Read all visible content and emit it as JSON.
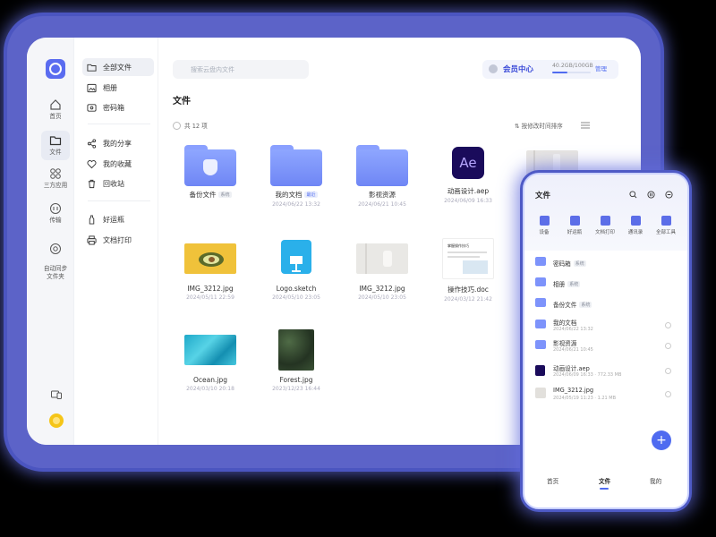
{
  "rail": {
    "items": [
      {
        "label": "首页",
        "icon": "home-icon"
      },
      {
        "label": "文件",
        "icon": "folder-icon"
      },
      {
        "label": "三方应用",
        "icon": "apps-icon"
      },
      {
        "label": "传输",
        "icon": "transfer-icon"
      },
      {
        "label": "自动同步\n文件夹",
        "icon": "sync-icon"
      }
    ]
  },
  "sidebar": {
    "items": [
      {
        "label": "全部文件",
        "icon": "folder-icon"
      },
      {
        "label": "相册",
        "icon": "image-icon"
      },
      {
        "label": "密码箱",
        "icon": "safe-icon"
      },
      {
        "label": "我的分享",
        "icon": "share-icon"
      },
      {
        "label": "我的收藏",
        "icon": "heart-icon"
      },
      {
        "label": "回收站",
        "icon": "trash-icon"
      },
      {
        "label": "好运瓶",
        "icon": "bottle-icon"
      },
      {
        "label": "文档打印",
        "icon": "printer-icon"
      }
    ]
  },
  "header": {
    "search_placeholder": "搜索云盘内文件",
    "vip_label": "会员中心",
    "storage": "40.2GB/100GB",
    "storage_used_fraction": 0.402,
    "manage_label": "管理"
  },
  "main": {
    "title": "文件",
    "count_label": "共 12 项",
    "sort_label": "按修改时间排序",
    "files": [
      {
        "name": "备份文件",
        "tag": "系统",
        "meta": ""
      },
      {
        "name": "我的文档",
        "tag": "最近",
        "meta": "2024/06/22 13:32"
      },
      {
        "name": "影视资源",
        "tag": "",
        "meta": "2024/06/21 10:45"
      },
      {
        "name": "动画设计.aep",
        "tag": "",
        "meta": "2024/06/09 16:33"
      },
      {
        "name": "IMG_3212.jpg",
        "tag": "",
        "meta": "2024/05/11 22:59"
      },
      {
        "name": "Logo.sketch",
        "tag": "",
        "meta": "2024/05/10 23:05"
      },
      {
        "name": "IMG_3212.jpg",
        "tag": "",
        "meta": "2024/05/10 23:05"
      },
      {
        "name": "操作技巧.doc",
        "tag": "",
        "meta": "2024/03/12 21:42"
      },
      {
        "name": "Ocean.jpg",
        "tag": "",
        "meta": "2024/03/10 20:18"
      },
      {
        "name": "Forest.jpg",
        "tag": "",
        "meta": "2023/12/23 16:44"
      }
    ],
    "ae_label": "Ae",
    "doc_title": "掌握操作技巧"
  },
  "phone": {
    "title": "文件",
    "tools": [
      "设备",
      "好运瓶",
      "文档打印",
      "通讯录",
      "全部工具"
    ],
    "list": [
      {
        "name": "密码箱",
        "tag": "系统",
        "meta": ""
      },
      {
        "name": "相册",
        "tag": "系统",
        "meta": ""
      },
      {
        "name": "备份文件",
        "tag": "系统",
        "meta": ""
      },
      {
        "name": "我的文档",
        "tag": "",
        "meta": "2024/06/22 13:32"
      },
      {
        "name": "影视资源",
        "tag": "",
        "meta": "2024/06/21 10:45"
      },
      {
        "name": "动画设计.aep",
        "tag": "",
        "meta": "2024/06/09 16:33 · 772.33 MB"
      },
      {
        "name": "IMG_3212.jpg",
        "tag": "",
        "meta": "2024/05/19 11:23 · 1.21 MB"
      }
    ],
    "fab_label": "+",
    "tabs": [
      "首页",
      "文件",
      "我的"
    ]
  },
  "colors": {
    "accent": "#4f6bf0",
    "frame": "#5c63c8"
  }
}
